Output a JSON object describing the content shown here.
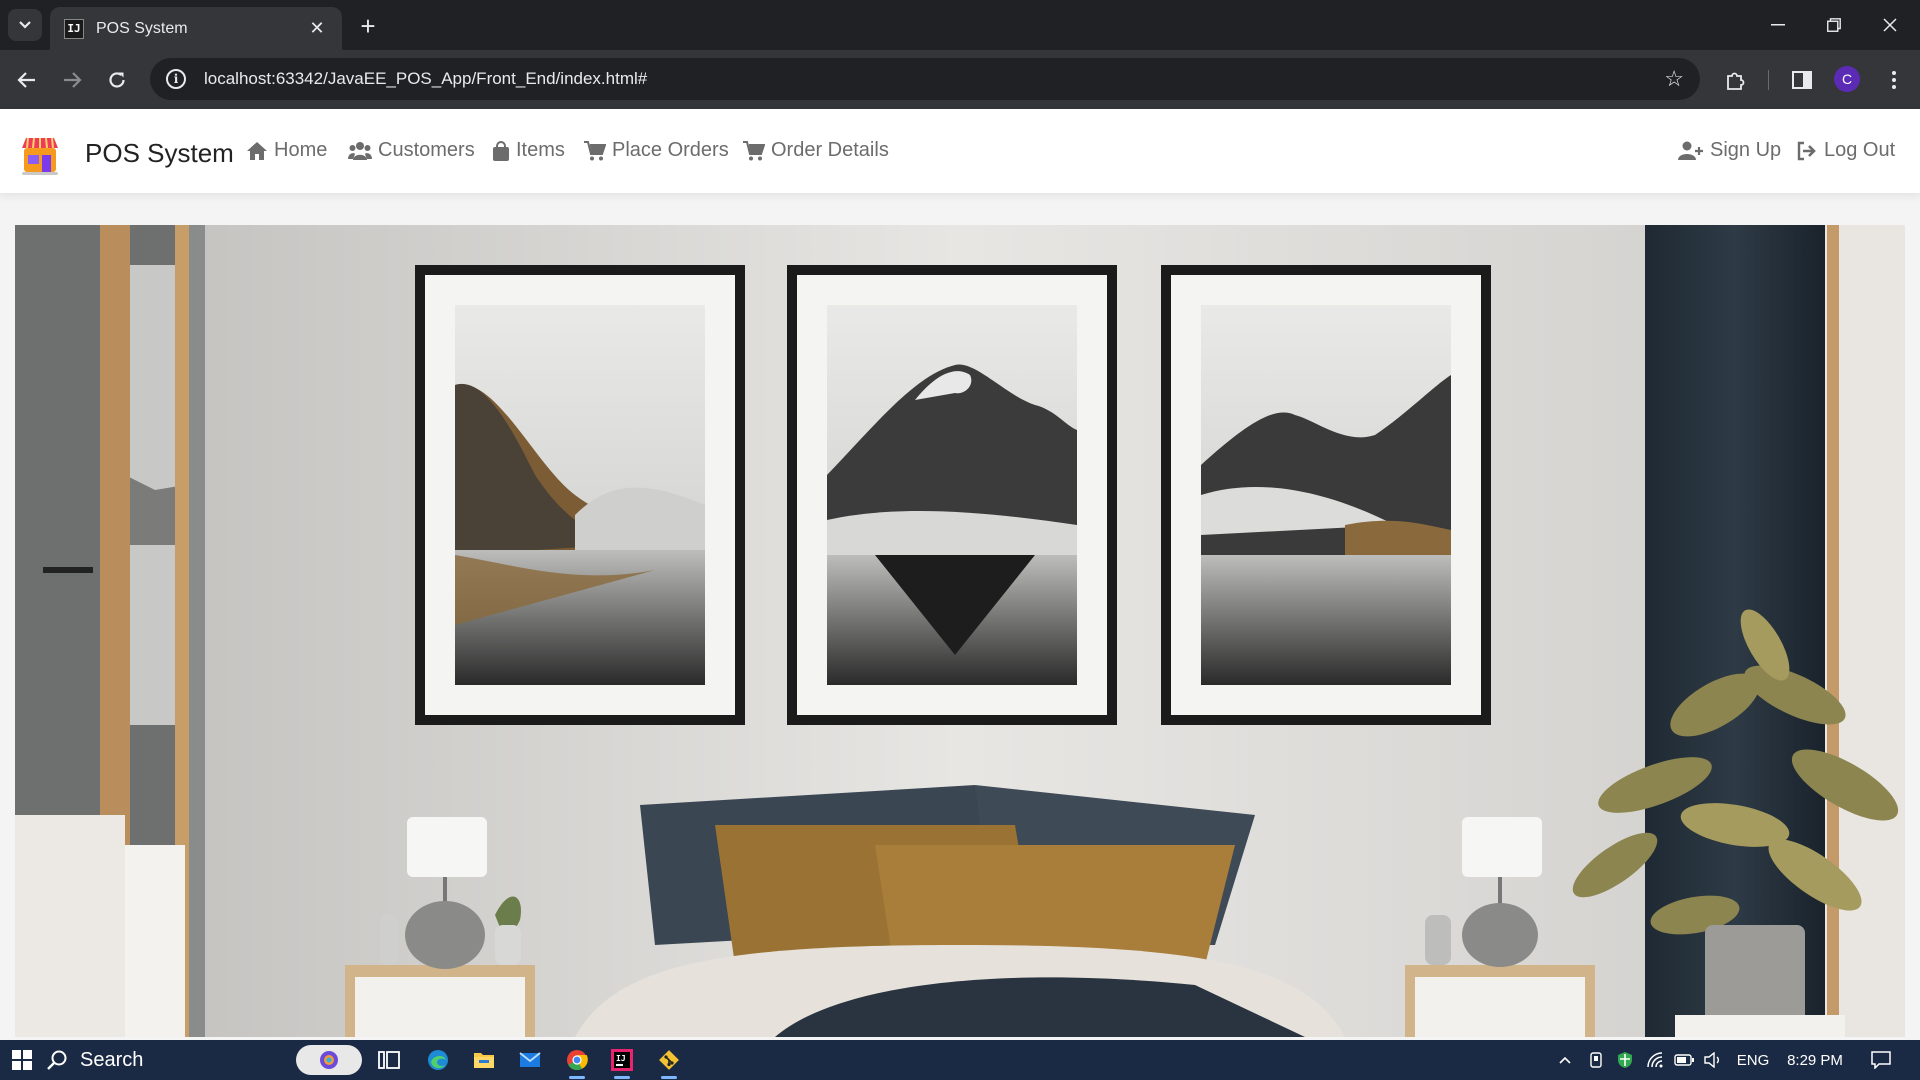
{
  "browser": {
    "tab_title": "POS System",
    "tab_favicon": "IJ",
    "url": "localhost:63342/JavaEE_POS_App/Front_End/index.html#",
    "profile_initial": "C"
  },
  "navbar": {
    "brand": "POS System",
    "links": [
      {
        "label": "Home",
        "icon": "home-icon"
      },
      {
        "label": "Customers",
        "icon": "users-icon"
      },
      {
        "label": "Items",
        "icon": "shopping-bag-icon"
      },
      {
        "label": "Place Orders",
        "icon": "cart-icon"
      },
      {
        "label": "Order Details",
        "icon": "cart-icon"
      }
    ],
    "right_links": [
      {
        "label": "Sign Up",
        "icon": "user-plus-icon"
      },
      {
        "label": "Log Out",
        "icon": "sign-out-icon"
      }
    ]
  },
  "hero": {
    "image": "bedroom-interior-with-three-mountain-lake-prints"
  },
  "taskbar": {
    "search_label": "Search",
    "language": "ENG",
    "time": "8:29 PM"
  }
}
